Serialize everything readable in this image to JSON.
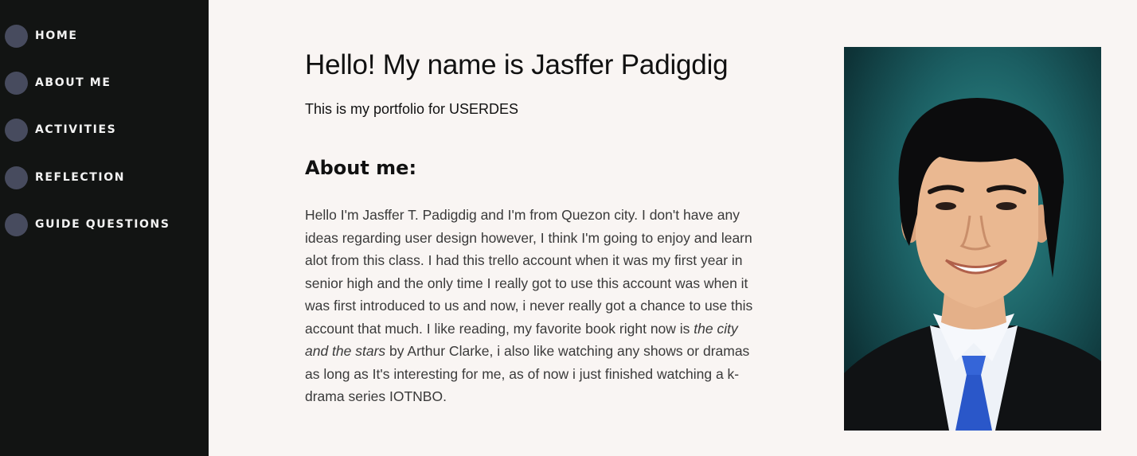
{
  "sidebar": {
    "items": [
      {
        "label": "HOME"
      },
      {
        "label": "ABOUT ME"
      },
      {
        "label": "ACTIVITIES"
      },
      {
        "label": "REFLECTION"
      },
      {
        "label": "GUIDE QUESTIONS"
      }
    ]
  },
  "main": {
    "title": "Hello! My name is Jasffer Padigdig",
    "subtitle": "This is my portfolio for USERDES",
    "about_heading": "About me:",
    "about_text_before": "Hello I'm Jasffer T. Padigdig and I'm from Quezon city. I don't have any ideas regarding user design however, I think I'm going to enjoy and learn alot from this class. I had this trello account when it was my first year in senior high and the only time I really got to use this account was when it was first introduced to us and now, i never really got a chance to use this account that much. I like reading, my favorite book right now is ",
    "about_text_italic": "the city and the stars",
    "about_text_after": " by Arthur Clarke, i also like watching any shows or dramas as long as It's interesting for me, as of now i just finished watching a k-drama series IOTNBO."
  },
  "colors": {
    "sidebar_bg": "#121413",
    "nav_dot": "#474b5e",
    "page_bg": "#f9f5f3",
    "photo_bg": "#1b5e62",
    "tie": "#2a57c9"
  },
  "icons": {
    "nav_bullet": "circle",
    "photo": "portrait-photo"
  }
}
